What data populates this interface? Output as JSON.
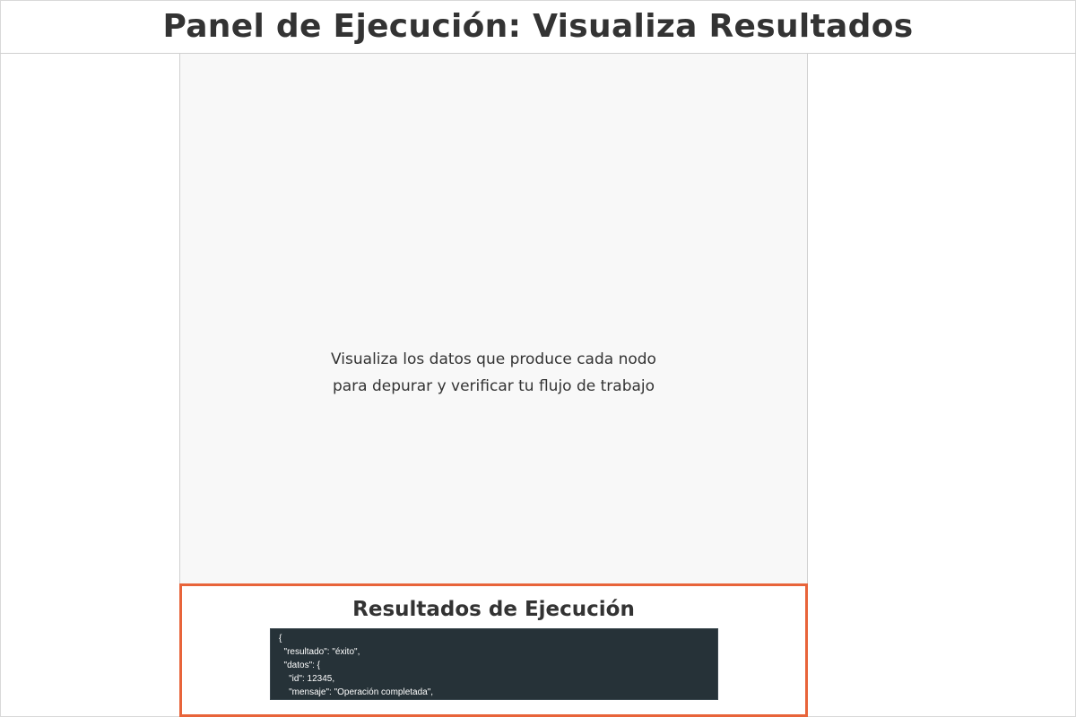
{
  "header": {
    "title": "Panel de Ejecución: Visualiza Resultados"
  },
  "canvas": {
    "line1": "Visualiza los datos que produce cada nodo",
    "line2": "para depurar y verificar tu flujo de trabajo"
  },
  "results": {
    "title": "Resultados de Ejecución",
    "code_lines": [
      "{",
      "  \"resultado\": \"éxito\",",
      "  \"datos\": {",
      "    \"id\": 12345,",
      "    \"mensaje\": \"Operación completada\","
    ]
  },
  "colors": {
    "accent": "#e8643a",
    "code_bg": "#263238",
    "canvas_bg": "#f8f8f8"
  }
}
